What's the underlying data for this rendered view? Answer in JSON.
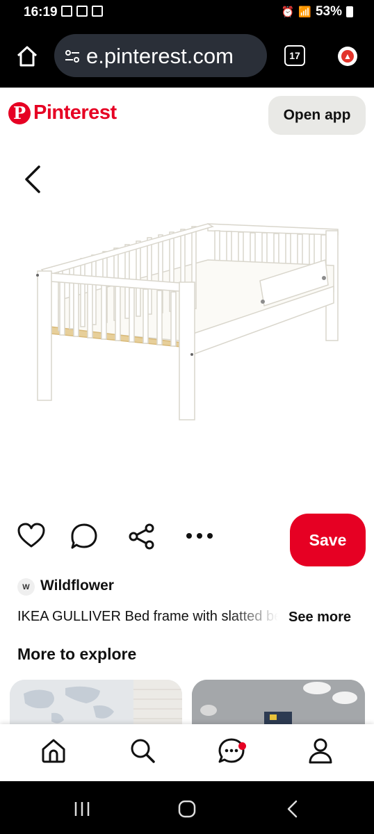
{
  "status_bar": {
    "time": "16:19",
    "battery": "53%"
  },
  "browser": {
    "url": "e.pinterest.com",
    "tab_count": "17"
  },
  "header": {
    "logo_text": "Pinterest",
    "open_app_label": "Open app"
  },
  "pin": {
    "save_label": "Save",
    "creator_initial": "W",
    "creator_name": "Wildflower",
    "description": "IKEA GULLIVER Bed frame with slatted bed base",
    "see_more_label": "See more"
  },
  "explore": {
    "heading": "More to explore"
  },
  "colors": {
    "brand": "#e60023",
    "open_app_bg": "#e9e9e6"
  },
  "icons": {
    "bottom_nav": [
      "home-icon",
      "search-icon",
      "messages-icon",
      "profile-icon"
    ],
    "actions": [
      "heart-icon",
      "comment-icon",
      "share-icon",
      "more-icon"
    ]
  }
}
